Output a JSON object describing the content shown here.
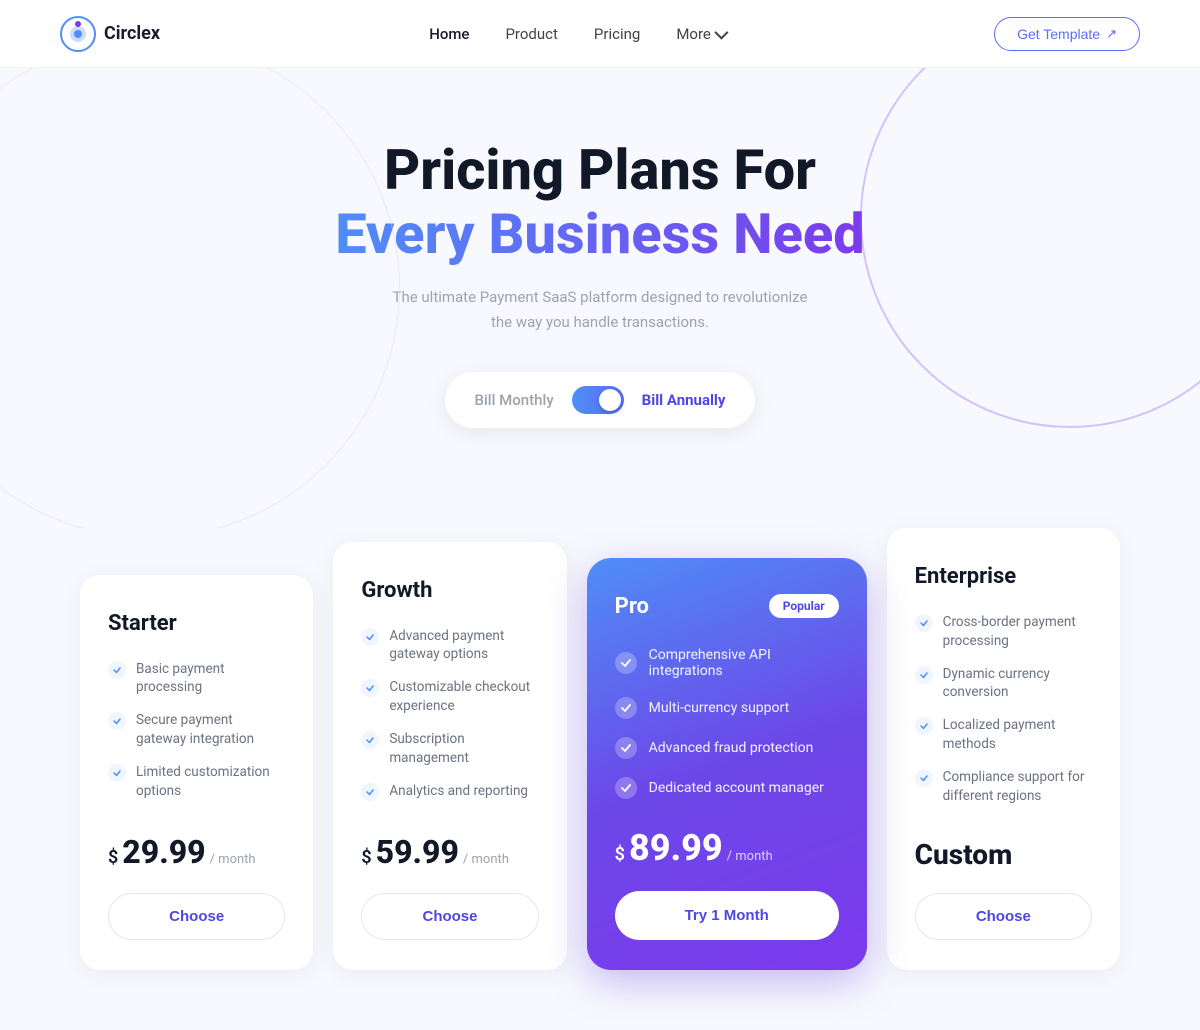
{
  "brand": {
    "name": "Circlex"
  },
  "nav": {
    "links": [
      {
        "label": "Home",
        "active": true
      },
      {
        "label": "Product",
        "active": false
      },
      {
        "label": "Pricing",
        "active": false
      },
      {
        "label": "More",
        "active": false
      }
    ],
    "cta": "Get Template"
  },
  "hero": {
    "heading_line1": "Pricing Plans For",
    "heading_line2": "Every Business Need",
    "subtitle_line1": "The ultimate Payment SaaS platform designed to revolutionize",
    "subtitle_line2": "the way you handle transactions.",
    "toggle_left": "Bill Monthly",
    "toggle_right": "Bill Annually"
  },
  "plans": {
    "starter": {
      "title": "Starter",
      "features": [
        "Basic payment processing",
        "Secure payment gateway integration",
        "Limited customization options"
      ],
      "price_dollar": "$",
      "price": "29.99",
      "period": "/ month",
      "cta": "Choose"
    },
    "growth": {
      "title": "Growth",
      "features": [
        "Advanced payment gateway options",
        "Customizable checkout experience",
        "Subscription management",
        "Analytics and reporting"
      ],
      "price_dollar": "$",
      "price": "59.99",
      "period": "/ month",
      "cta": "Choose"
    },
    "pro": {
      "title": "Pro",
      "badge": "Popular",
      "features": [
        "Comprehensive API integrations",
        "Multi-currency support",
        "Advanced fraud protection",
        "Dedicated account manager"
      ],
      "price_dollar": "$",
      "price": "89.99",
      "period": "/ month",
      "cta": "Try 1 Month"
    },
    "enterprise": {
      "title": "Enterprise",
      "features": [
        "Cross-border payment processing",
        "Dynamic currency conversion",
        "Localized payment methods",
        "Compliance support for different regions"
      ],
      "price_custom": "Custom",
      "cta": "Choose"
    }
  }
}
